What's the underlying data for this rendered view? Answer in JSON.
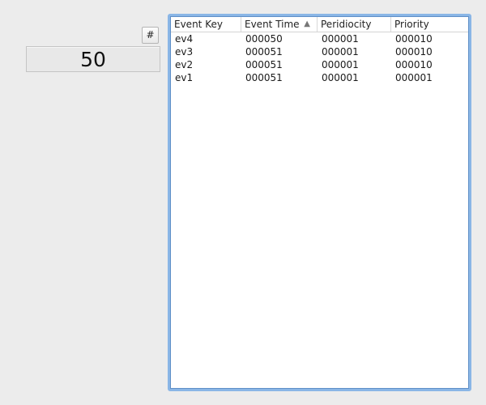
{
  "controls": {
    "hash_button_label": "#",
    "counter_display": "50"
  },
  "table": {
    "columns": [
      "Event Key",
      "Event Time",
      "Peridiocity",
      "Priority"
    ],
    "sort_column": "Event Time",
    "sort_direction": "ascending",
    "sort_indicator": "▲",
    "rows": [
      [
        "ev4",
        "000050",
        "000001",
        "000010"
      ],
      [
        "ev3",
        "000051",
        "000001",
        "000010"
      ],
      [
        "ev2",
        "000051",
        "000001",
        "000010"
      ],
      [
        "ev1",
        "000051",
        "000001",
        "000001"
      ]
    ]
  }
}
